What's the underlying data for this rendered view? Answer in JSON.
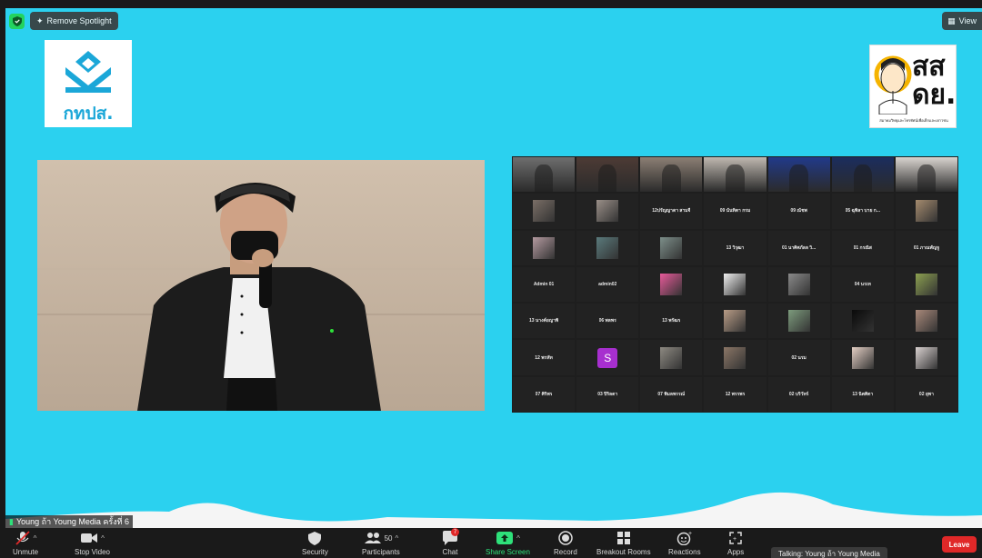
{
  "top": {
    "remove_spotlight": "Remove Spotlight",
    "view_label": "View"
  },
  "logos": {
    "left_text": "กทปส.",
    "right_big": "สส\nดย.",
    "right_small": "สมาคมวิทยุและโทรทัศน์เพื่อเด็กและเยาวชน"
  },
  "gallery": {
    "tiles": [
      {
        "kind": "video",
        "color": "#6e6e6e"
      },
      {
        "kind": "video",
        "color": "#4d3b35"
      },
      {
        "kind": "video",
        "color": "#8c7f74"
      },
      {
        "kind": "video",
        "color": "#bfb8b0"
      },
      {
        "kind": "video",
        "color": "#213a8a"
      },
      {
        "kind": "video",
        "color": "#1b2d5e"
      },
      {
        "kind": "video",
        "color": "#d9d4cf"
      },
      {
        "kind": "thumb",
        "color": "#7a6e66"
      },
      {
        "kind": "thumb",
        "color": "#9a8f88"
      },
      {
        "kind": "name",
        "text": "12ปรัญญาดา สามจี"
      },
      {
        "kind": "name",
        "text": "09 นันทิตา กรม"
      },
      {
        "kind": "name",
        "text": "09 ณัชพ"
      },
      {
        "kind": "name",
        "text": "05 ฉุพิลา บาย ก..."
      },
      {
        "kind": "thumb",
        "color": "#a58b6e"
      },
      {
        "kind": "thumb",
        "color": "#b49aa0"
      },
      {
        "kind": "thumb",
        "color": "#5a7a7c"
      },
      {
        "kind": "thumb",
        "color": "#7d8f8a"
      },
      {
        "kind": "name",
        "text": "13 วิรุฒา"
      },
      {
        "kind": "name",
        "text": "01 นาศิศภัลล วิ..."
      },
      {
        "kind": "name",
        "text": "01 กรณิส"
      },
      {
        "kind": "name",
        "text": "01 ภาณพัญจู"
      },
      {
        "kind": "name",
        "text": "Admin 01"
      },
      {
        "kind": "name",
        "text": "admin02"
      },
      {
        "kind": "thumb",
        "color": "#e85a9a"
      },
      {
        "kind": "thumb",
        "color": "#f0f0f0"
      },
      {
        "kind": "thumb",
        "color": "#8a8a8a"
      },
      {
        "kind": "name",
        "text": "04 นรเท"
      },
      {
        "kind": "thumb",
        "color": "#8ca050"
      },
      {
        "kind": "name",
        "text": "13 นางค์ยญาพิ"
      },
      {
        "kind": "name",
        "text": "06 พลพร"
      },
      {
        "kind": "name",
        "text": "13 พรัฒร"
      },
      {
        "kind": "thumb",
        "color": "#b89c86"
      },
      {
        "kind": "thumb",
        "color": "#7d9c7d"
      },
      {
        "kind": "thumb",
        "color": "#0a0a0a"
      },
      {
        "kind": "thumb",
        "color": "#a9897a"
      },
      {
        "kind": "name",
        "text": "12 พรหัท"
      },
      {
        "kind": "avatar",
        "text": "S"
      },
      {
        "kind": "thumb",
        "color": "#8e8a82"
      },
      {
        "kind": "thumb",
        "color": "#8b7666"
      },
      {
        "kind": "name",
        "text": "02 นรม"
      },
      {
        "kind": "thumb",
        "color": "#e4cfc4"
      },
      {
        "kind": "thumb",
        "color": "#d9d1d0"
      },
      {
        "kind": "name",
        "text": "07 ศิริพร"
      },
      {
        "kind": "name",
        "text": "03 ปิริลดา"
      },
      {
        "kind": "name",
        "text": "07 พิมลพรรณ์"
      },
      {
        "kind": "name",
        "text": "12 พรรพร"
      },
      {
        "kind": "name",
        "text": "02 บริวัทร์"
      },
      {
        "kind": "name",
        "text": "13 นิตศิตา"
      },
      {
        "kind": "name",
        "text": "02 ยุพา"
      }
    ]
  },
  "talking_overlay": "Young ถ้า Young Media ครั้งที่ 6",
  "toolbar": {
    "unmute": "Unmute",
    "stop_video": "Stop Video",
    "security": "Security",
    "participants": "Participants",
    "participants_count": "50",
    "chat": "Chat",
    "chat_badge": "7",
    "share_screen": "Share Screen",
    "record": "Record",
    "breakout": "Breakout Rooms",
    "reactions": "Reactions",
    "apps": "Apps",
    "leave": "Leave",
    "talking_tip": "Talking: Young ถ้า Young Media"
  },
  "colors": {
    "background": "#2bd1ef",
    "leave": "#e02828",
    "share": "#2ee17a",
    "security_green": "#23d35f"
  }
}
